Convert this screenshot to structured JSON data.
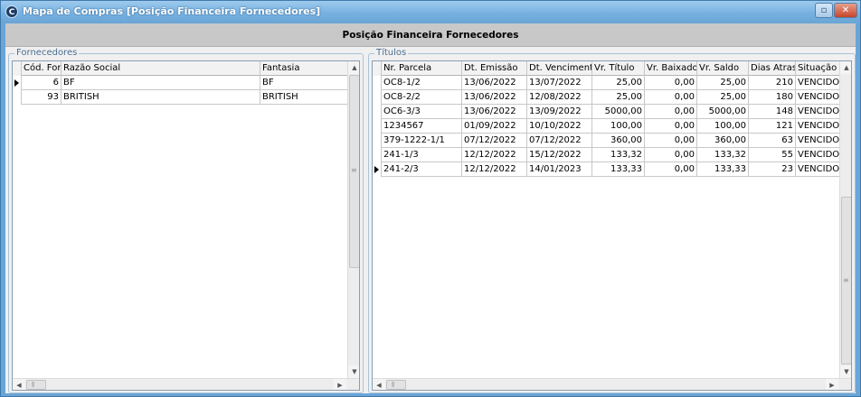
{
  "window": {
    "title": "Mapa de Compras [Posição Financeira Fornecedores]",
    "app_icon_glyph": "C",
    "restore_glyph": "▫",
    "close_glyph": "✕"
  },
  "header": {
    "title": "Posição Financeira Fornecedores"
  },
  "fornecedores": {
    "group_label": "Fornecedores",
    "columns": [
      "Cód. For.",
      "Razão Social",
      "Fantasia"
    ],
    "rows": [
      {
        "codigo": "6",
        "razao": "BF",
        "fantasia": "BF"
      },
      {
        "codigo": "93",
        "razao": "BRITISH",
        "fantasia": "BRITISH"
      }
    ]
  },
  "titulos": {
    "group_label": "Títulos",
    "columns": [
      "Nr. Parcela",
      "Dt. Emissão",
      "Dt. Vencimento",
      "Vr. Título",
      "Vr. Baixados",
      "Vr. Saldo",
      "Dias Atraso",
      "Situação"
    ],
    "rows": [
      {
        "parcela": "OC8-1/2",
        "emissao": "13/06/2022",
        "vencimento": "13/07/2022",
        "titulo": "25,00",
        "baixados": "0,00",
        "saldo": "25,00",
        "atraso": "210",
        "situacao": "VENCIDOS"
      },
      {
        "parcela": "OC8-2/2",
        "emissao": "13/06/2022",
        "vencimento": "12/08/2022",
        "titulo": "25,00",
        "baixados": "0,00",
        "saldo": "25,00",
        "atraso": "180",
        "situacao": "VENCIDOS"
      },
      {
        "parcela": "OC6-3/3",
        "emissao": "13/06/2022",
        "vencimento": "13/09/2022",
        "titulo": "5000,00",
        "baixados": "0,00",
        "saldo": "5000,00",
        "atraso": "148",
        "situacao": "VENCIDOS"
      },
      {
        "parcela": "1234567",
        "emissao": "01/09/2022",
        "vencimento": "10/10/2022",
        "titulo": "100,00",
        "baixados": "0,00",
        "saldo": "100,00",
        "atraso": "121",
        "situacao": "VENCIDOS"
      },
      {
        "parcela": "379-1222-1/1",
        "emissao": "07/12/2022",
        "vencimento": "07/12/2022",
        "titulo": "360,00",
        "baixados": "0,00",
        "saldo": "360,00",
        "atraso": "63",
        "situacao": "VENCIDOS"
      },
      {
        "parcela": "241-1/3",
        "emissao": "12/12/2022",
        "vencimento": "15/12/2022",
        "titulo": "133,32",
        "baixados": "0,00",
        "saldo": "133,32",
        "atraso": "55",
        "situacao": "VENCIDOS"
      },
      {
        "parcela": "241-2/3",
        "emissao": "12/12/2022",
        "vencimento": "14/01/2023",
        "titulo": "133,33",
        "baixados": "0,00",
        "saldo": "133,33",
        "atraso": "23",
        "situacao": "VENCIDOS"
      }
    ]
  },
  "scroll": {
    "up": "▲",
    "down": "▼",
    "left": "◀",
    "right": "▶",
    "grip_v": "≡",
    "grip_h": "⦀"
  },
  "colors": {
    "title_bar": "#79b2e1",
    "header_band": "#c8c8c8",
    "group_border": "#a8c4dc"
  }
}
